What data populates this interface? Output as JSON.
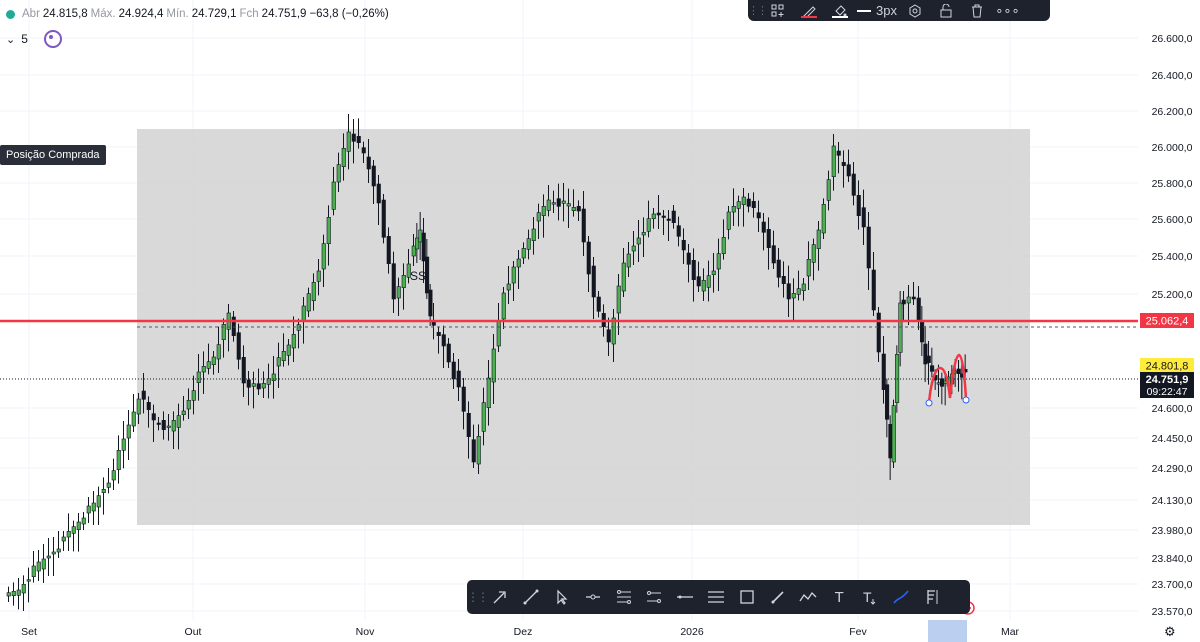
{
  "ohlc": {
    "open_label": "Abr",
    "open_value": "24.815,8",
    "high_label": "Máx.",
    "high_value": "24.924,4",
    "low_label": "Mín.",
    "low_value": "24.729,1",
    "close_label": "Fch",
    "close_value": "24.751,9",
    "change": "−63,8 (−0,26%)"
  },
  "indicator": {
    "chevron": "⌄",
    "value": "5"
  },
  "position_label": "Posição Comprada",
  "price_axis": {
    "ticks": [
      "26.600,0",
      "26.400,0",
      "26.200,0",
      "26.000,0",
      "25.800,0",
      "25.600,0",
      "25.400,0",
      "25.200,0",
      "24.600,0",
      "24.450,0",
      "24.290,0",
      "24.130,0",
      "23.980,0",
      "23.840,0",
      "23.700,0",
      "23.570,0"
    ],
    "level_red": "25.062,4",
    "level_yellow": "24.801,8",
    "last_price": "24.751,9",
    "countdown": "09:22:47",
    "colors": {
      "red": "#f23645",
      "yellow": "#ffeb3b",
      "dark": "#131722"
    }
  },
  "time_axis": {
    "labels": [
      "Set",
      "Out",
      "Nov",
      "Dez",
      "2026",
      "Fev",
      "Mar"
    ]
  },
  "top_toolbar": {
    "width_label": "3px",
    "more_label": "∘∘∘"
  },
  "bottom_toolbar": {
    "tools": [
      "arrow-tool-icon",
      "trend-line-icon",
      "cursor-arrow-icon",
      "horizontal-ray-icon",
      "parallel-channel-icon",
      "channel-icon",
      "horizontal-line-icon",
      "lines-icon",
      "rectangle-icon",
      "pencil-icon",
      "path-icon",
      "text-icon",
      "text-format-icon",
      "brush-icon",
      "long-position-icon"
    ],
    "text_glyph": "T"
  },
  "chart_data": {
    "type": "candlestick",
    "annotation": "SS",
    "y_range": [
      23500,
      26700
    ],
    "x_labels": [
      "Set",
      "Out",
      "Nov",
      "Dez",
      "2026",
      "Fev",
      "Mar"
    ],
    "levels": [
      25062.4,
      24801.8,
      24751.9
    ]
  }
}
